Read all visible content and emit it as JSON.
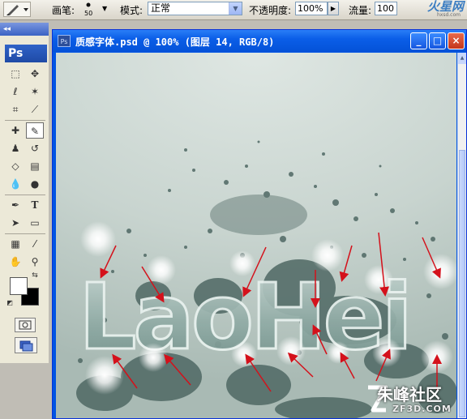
{
  "options_bar": {
    "brush_label": "画笔:",
    "brush_size": "50",
    "mode_label": "模式:",
    "mode_value": "正常",
    "opacity_label": "不透明度:",
    "opacity_value": "100%",
    "flow_label": "流量:",
    "flow_value": "100"
  },
  "watermark_top": {
    "logo": "火星网",
    "sub": "hxsd.com"
  },
  "toolbox": {
    "ps_label": "Ps"
  },
  "document": {
    "title": "质感字体.psd @ 100% (图层 14, RGB/8)",
    "artwork_text": "LaoHei",
    "window_buttons": {
      "minimize": "_",
      "maximize": "□",
      "close": "×"
    }
  },
  "watermark_bottom": {
    "cn": "朱峰社区",
    "url": "ZF3D.COM"
  },
  "colors": {
    "arrow": "#d4111b",
    "title_bar": "#0b5ee8",
    "canvas_bg": "#c8d4cf",
    "glow_text": "#9fb3ae"
  }
}
